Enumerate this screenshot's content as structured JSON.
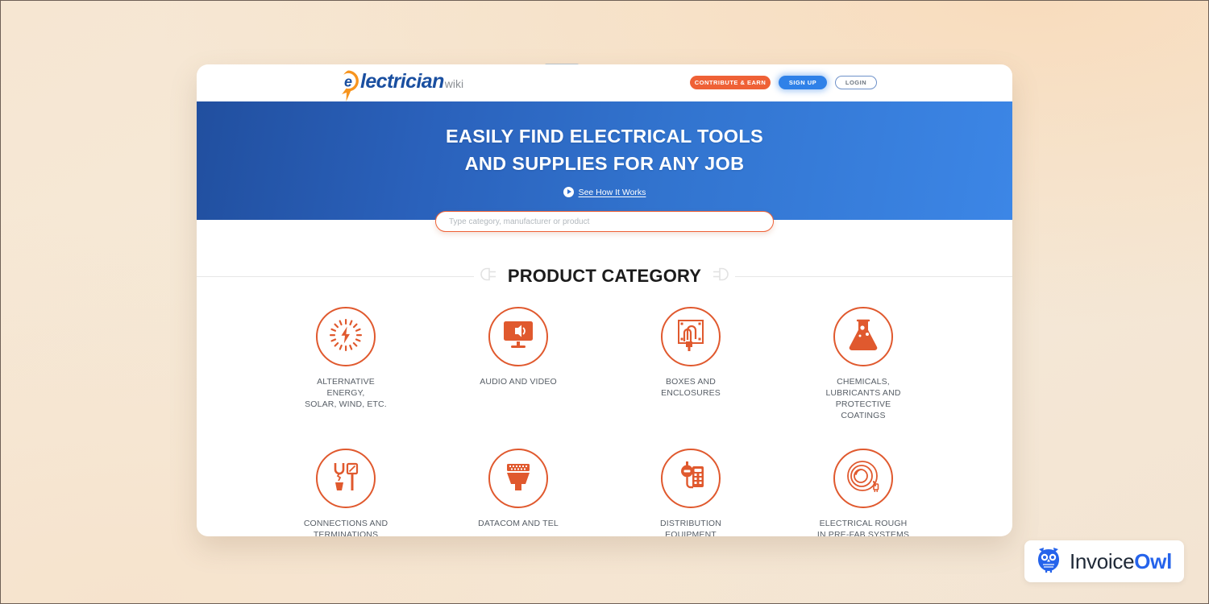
{
  "background": {
    "color_start": "#f8dcbd",
    "color_end": "#f3e4d2"
  },
  "browser": {
    "tab_stub": ""
  },
  "header": {
    "logo": {
      "mark": "e-speech-bubble-bolt",
      "name": "lectrician",
      "suffix": "wiki",
      "accent_color": "#ef6136",
      "text_color": "#1a4fa0"
    },
    "buttons": [
      {
        "label": "CONTRIBUTE & EARN",
        "style": "solid-orange",
        "color": "#ef6136"
      },
      {
        "label": "SIGN UP",
        "style": "solid-blue",
        "color": "#2f81e8"
      },
      {
        "label": "LOGIN",
        "style": "outline",
        "color": "#6e91c9"
      }
    ]
  },
  "hero": {
    "headline_line1": "EASILY FIND ELECTRICAL TOOLS",
    "headline_line2": "AND SUPPLIES FOR ANY JOB",
    "video_link": "See How It Works",
    "video_icon": "play-circle-icon",
    "gradient_start": "#214f9f",
    "gradient_end": "#3c86e6"
  },
  "search": {
    "placeholder": "Type category, manufacturer or product",
    "value": "",
    "border_color": "#ef6136"
  },
  "section": {
    "title": "PRODUCT CATEGORY",
    "left_icon": "plug-icon",
    "right_icon": "socket-icon"
  },
  "categories": [
    {
      "icon": "sun-lightning-icon",
      "label": "ALTERNATIVE ENERGY,\nSOLAR, WIND, ETC."
    },
    {
      "icon": "monitor-speaker-icon",
      "label": "AUDIO AND VIDEO"
    },
    {
      "icon": "junction-box-icon",
      "label": "BOXES AND\nENCLOSURES"
    },
    {
      "icon": "flask-icon",
      "label": "CHEMICALS,\nLUBRICANTS AND\nPROTECTIVE\nCOATINGS"
    },
    {
      "icon": "wire-connector-icon",
      "label": "CONNECTIONS AND\nTERMINATIONS"
    },
    {
      "icon": "rj45-jack-icon",
      "label": "DATACOM AND TEL"
    },
    {
      "icon": "meter-panel-icon",
      "label": "DISTRIBUTION\nEQUIPMENT"
    },
    {
      "icon": "coiled-cable-icon",
      "label": "ELECTRICAL ROUGH\nIN PRE-FAB SYSTEMS"
    }
  ],
  "watermark": {
    "icon": "owl-icon",
    "text_primary": "Invoice",
    "text_accent": "Owl",
    "accent_color": "#2563eb"
  }
}
